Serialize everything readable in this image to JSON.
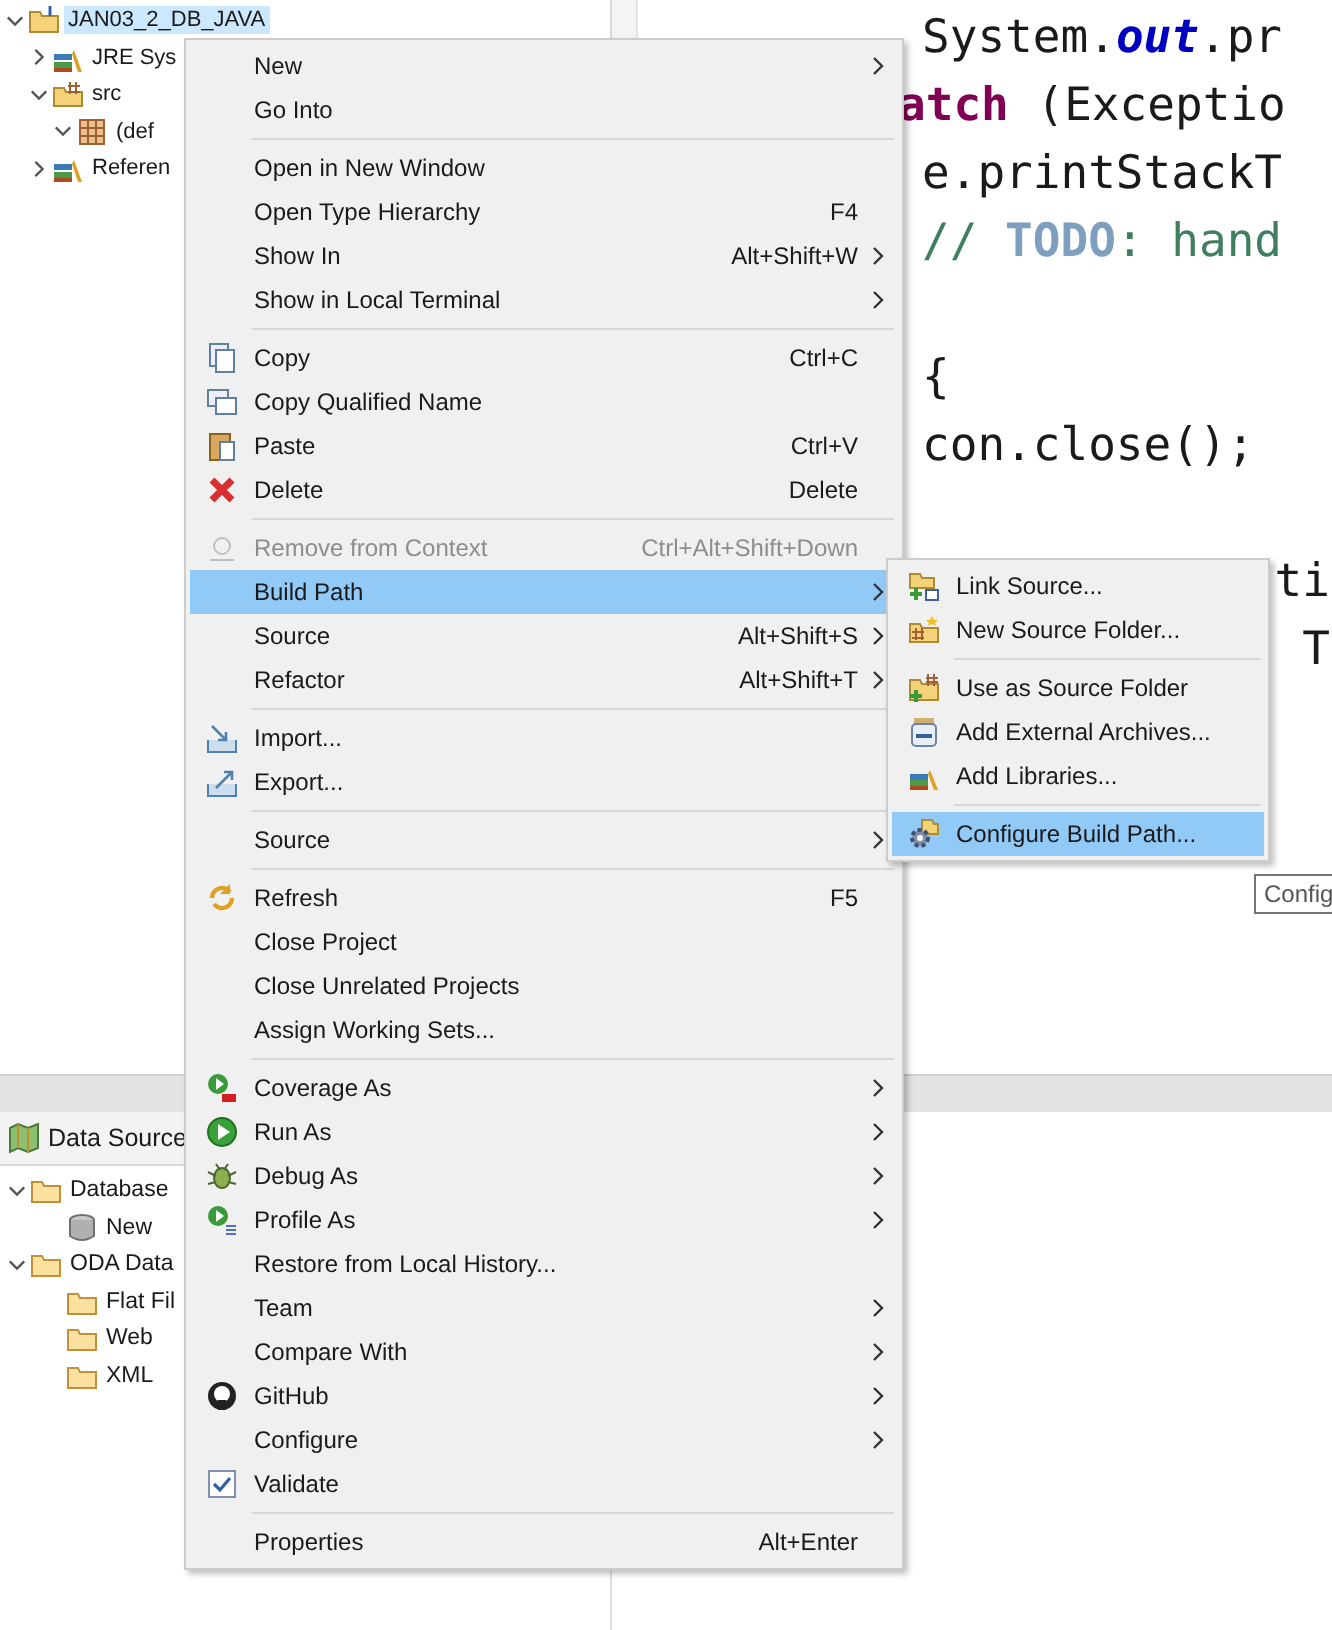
{
  "project_tree": {
    "items": [
      {
        "label": "JAN03_2_DB_JAVA",
        "kind": "project",
        "expanded": true,
        "selected": true,
        "children": [
          {
            "label": "JRE Sys",
            "kind": "library",
            "expanded": false,
            "selected": false
          },
          {
            "label": "src",
            "kind": "source-folder",
            "expanded": true,
            "selected": false,
            "children": [
              {
                "label": "(def",
                "kind": "package",
                "expanded": true,
                "selected": false
              }
            ]
          },
          {
            "label": "Referen",
            "kind": "library",
            "expanded": false,
            "selected": false
          }
        ]
      }
    ]
  },
  "editor": {
    "code_lines": [
      {
        "kind": "code",
        "segments": [
          {
            "text": "System.",
            "kind": "plain"
          },
          {
            "text": "out",
            "kind": "field"
          },
          {
            "text": ".pr",
            "kind": "plain"
          }
        ]
      },
      {
        "kind": "covered",
        "segments": [
          {
            "text": "atch",
            "kind": "keyword"
          },
          {
            "text": " (Exceptio",
            "kind": "plain"
          }
        ]
      },
      {
        "kind": "code",
        "segments": [
          {
            "text": "e.printStackT",
            "kind": "plain"
          }
        ]
      },
      {
        "kind": "code",
        "segments": [
          {
            "text": "// ",
            "kind": "comment"
          },
          {
            "text": "TODO",
            "kind": "task"
          },
          {
            "text": ": hand",
            "kind": "comment"
          }
        ]
      },
      {
        "kind": "blank"
      },
      {
        "kind": "code",
        "segments": [
          {
            "text": "{",
            "kind": "plain"
          }
        ]
      },
      {
        "kind": "code",
        "segments": [
          {
            "text": "con.close();",
            "kind": "plain"
          }
        ]
      },
      {
        "kind": "blank"
      },
      {
        "kind": "covered-end",
        "segments": [
          {
            "text": "ti",
            "kind": "plain"
          }
        ]
      },
      {
        "kind": "covered-end",
        "segments": [
          {
            "text": "T",
            "kind": "plain"
          }
        ]
      }
    ]
  },
  "data_source_panel": {
    "title": "Data Source",
    "items": [
      {
        "label": "Database",
        "kind": "folder",
        "expanded": true,
        "children": [
          {
            "label": "New",
            "kind": "database"
          }
        ]
      },
      {
        "label": "ODA Data",
        "kind": "folder",
        "expanded": true,
        "children": [
          {
            "label": "Flat Fil",
            "kind": "folder"
          },
          {
            "label": "Web",
            "kind": "folder"
          },
          {
            "label": "XML",
            "kind": "folder"
          }
        ]
      }
    ]
  },
  "context_menu": {
    "items": [
      {
        "kind": "item",
        "label": "New",
        "submenu": true,
        "selected": false,
        "disabled": false
      },
      {
        "kind": "item",
        "label": "Go Into",
        "submenu": false,
        "selected": false,
        "disabled": false
      },
      {
        "kind": "separator"
      },
      {
        "kind": "item",
        "label": "Open in New Window",
        "submenu": false,
        "selected": false,
        "disabled": false
      },
      {
        "kind": "item",
        "label": "Open Type Hierarchy",
        "shortcut": "F4",
        "submenu": false,
        "selected": false,
        "disabled": false
      },
      {
        "kind": "item",
        "label": "Show In",
        "shortcut": "Alt+Shift+W",
        "submenu": true,
        "selected": false,
        "disabled": false
      },
      {
        "kind": "item",
        "label": "Show in Local Terminal",
        "submenu": true,
        "selected": false,
        "disabled": false
      },
      {
        "kind": "separator"
      },
      {
        "kind": "item",
        "label": "Copy",
        "shortcut": "Ctrl+C",
        "submenu": false,
        "selected": false,
        "disabled": false
      },
      {
        "kind": "item",
        "label": "Copy Qualified Name",
        "submenu": false,
        "selected": false,
        "disabled": false
      },
      {
        "kind": "item",
        "label": "Paste",
        "shortcut": "Ctrl+V",
        "submenu": false,
        "selected": false,
        "disabled": false
      },
      {
        "kind": "item",
        "label": "Delete",
        "shortcut": "Delete",
        "submenu": false,
        "selected": false,
        "disabled": false
      },
      {
        "kind": "separator"
      },
      {
        "kind": "item",
        "label": "Remove from Context",
        "shortcut": "Ctrl+Alt+Shift+Down",
        "submenu": false,
        "selected": false,
        "disabled": true
      },
      {
        "kind": "item",
        "label": "Build Path",
        "submenu": true,
        "selected": true,
        "disabled": false
      },
      {
        "kind": "item",
        "label": "Source",
        "shortcut": "Alt+Shift+S",
        "submenu": true,
        "selected": false,
        "disabled": false
      },
      {
        "kind": "item",
        "label": "Refactor",
        "shortcut": "Alt+Shift+T",
        "submenu": true,
        "selected": false,
        "disabled": false
      },
      {
        "kind": "separator"
      },
      {
        "kind": "item",
        "label": "Import...",
        "submenu": false,
        "selected": false,
        "disabled": false
      },
      {
        "kind": "item",
        "label": "Export...",
        "submenu": false,
        "selected": false,
        "disabled": false
      },
      {
        "kind": "separator"
      },
      {
        "kind": "item",
        "label": "Source",
        "submenu": true,
        "selected": false,
        "disabled": false
      },
      {
        "kind": "separator"
      },
      {
        "kind": "item",
        "label": "Refresh",
        "shortcut": "F5",
        "submenu": false,
        "selected": false,
        "disabled": false
      },
      {
        "kind": "item",
        "label": "Close Project",
        "submenu": false,
        "selected": false,
        "disabled": false
      },
      {
        "kind": "item",
        "label": "Close Unrelated Projects",
        "submenu": false,
        "selected": false,
        "disabled": false
      },
      {
        "kind": "item",
        "label": "Assign Working Sets...",
        "submenu": false,
        "selected": false,
        "disabled": false
      },
      {
        "kind": "separator"
      },
      {
        "kind": "item",
        "label": "Coverage As",
        "submenu": true,
        "selected": false,
        "disabled": false
      },
      {
        "kind": "item",
        "label": "Run As",
        "submenu": true,
        "selected": false,
        "disabled": false
      },
      {
        "kind": "item",
        "label": "Debug As",
        "submenu": true,
        "selected": false,
        "disabled": false
      },
      {
        "kind": "item",
        "label": "Profile As",
        "submenu": true,
        "selected": false,
        "disabled": false
      },
      {
        "kind": "item",
        "label": "Restore from Local History...",
        "submenu": false,
        "selected": false,
        "disabled": false
      },
      {
        "kind": "item",
        "label": "Team",
        "submenu": true,
        "selected": false,
        "disabled": false
      },
      {
        "kind": "item",
        "label": "Compare With",
        "submenu": true,
        "selected": false,
        "disabled": false
      },
      {
        "kind": "item",
        "label": "GitHub",
        "submenu": true,
        "selected": false,
        "disabled": false
      },
      {
        "kind": "item",
        "label": "Configure",
        "submenu": true,
        "selected": false,
        "disabled": false
      },
      {
        "kind": "item",
        "label": "Validate",
        "submenu": false,
        "selected": false,
        "disabled": false
      },
      {
        "kind": "separator"
      },
      {
        "kind": "item",
        "label": "Properties",
        "shortcut": "Alt+Enter",
        "submenu": false,
        "selected": false,
        "disabled": false
      }
    ]
  },
  "build_path_submenu": {
    "items": [
      {
        "kind": "item",
        "label": "Link Source...",
        "selected": false
      },
      {
        "kind": "item",
        "label": "New Source Folder...",
        "selected": false
      },
      {
        "kind": "separator"
      },
      {
        "kind": "item",
        "label": "Use as Source Folder",
        "selected": false
      },
      {
        "kind": "item",
        "label": "Add External Archives...",
        "selected": false
      },
      {
        "kind": "item",
        "label": "Add Libraries...",
        "selected": false
      },
      {
        "kind": "separator"
      },
      {
        "kind": "item",
        "label": "Configure Build Path...",
        "selected": true
      }
    ]
  },
  "tooltip": {
    "text": "Config"
  }
}
